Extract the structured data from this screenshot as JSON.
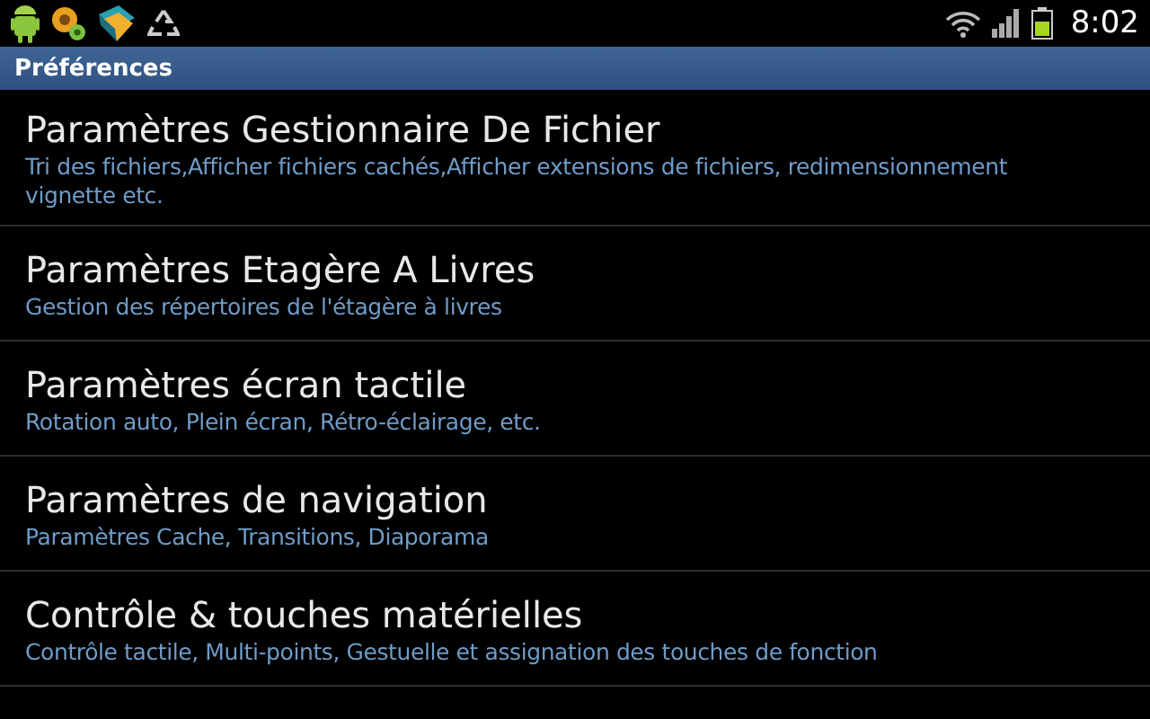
{
  "status_bar": {
    "time": "8:02"
  },
  "title_bar": {
    "title": "Préférences"
  },
  "items": [
    {
      "title": "Paramètres Gestionnaire De Fichier",
      "summary": "Tri des fichiers,Afficher fichiers cachés,Afficher extensions de fichiers, redimensionnement vignette etc."
    },
    {
      "title": "Paramètres Etagère A Livres",
      "summary": "Gestion des répertoires de l'étagère à livres"
    },
    {
      "title": "Paramètres écran tactile",
      "summary": "Rotation auto, Plein écran, Rétro-éclairage, etc."
    },
    {
      "title": "Paramètres de navigation",
      "summary": "Paramètres Cache, Transitions, Diaporama"
    },
    {
      "title": "Contrôle & touches matérielles",
      "summary": "Contrôle tactile, Multi-points, Gestuelle et assignation des touches de fonction"
    }
  ]
}
